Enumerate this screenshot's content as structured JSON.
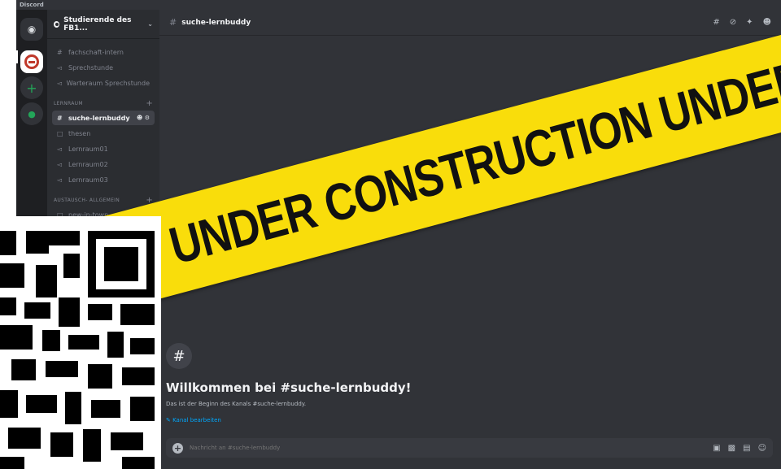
{
  "app": {
    "label": "Discord"
  },
  "server": {
    "name": "Studierende des FB1..."
  },
  "sidebar": {
    "channels_top": [
      {
        "type": "text",
        "label": "fachschaft-intern"
      },
      {
        "type": "voice",
        "label": "Sprechstunde"
      },
      {
        "type": "voice",
        "label": "Warteraum Sprechstunde"
      }
    ],
    "categories": [
      {
        "label": "LERNRAUM",
        "channels": [
          {
            "type": "text",
            "label": "suche-lernbuddy",
            "active": true
          },
          {
            "type": "forum",
            "label": "thesen"
          },
          {
            "type": "voice",
            "label": "Lernraum01"
          },
          {
            "type": "voice",
            "label": "Lernraum02"
          },
          {
            "type": "voice",
            "label": "Lernraum03"
          }
        ]
      },
      {
        "label": "AUSTAUSCH- ALLGEMEIN",
        "channels": [
          {
            "type": "forum",
            "label": "new-in-town"
          }
        ]
      }
    ]
  },
  "channel": {
    "name": "suche-lernbuddy",
    "welcome_title": "Willkommen bei #suche-lernbuddy!",
    "welcome_subtitle": "Das ist der Beginn des Kanals #suche-lernbuddy.",
    "edit_link": "Kanal bearbeiten"
  },
  "composer": {
    "placeholder": "Nachricht an #suche-lernbuddy"
  },
  "overlay": {
    "banner_text": "UNDER CONSTRUCTION  UNDER CONSTRUCTION"
  },
  "icons": {
    "text_channel": "#",
    "voice_channel": "speaker-icon",
    "forum_channel": "forum-icon"
  },
  "colors": {
    "tape": "#f9dd0b",
    "accent": "#00a8fc"
  }
}
